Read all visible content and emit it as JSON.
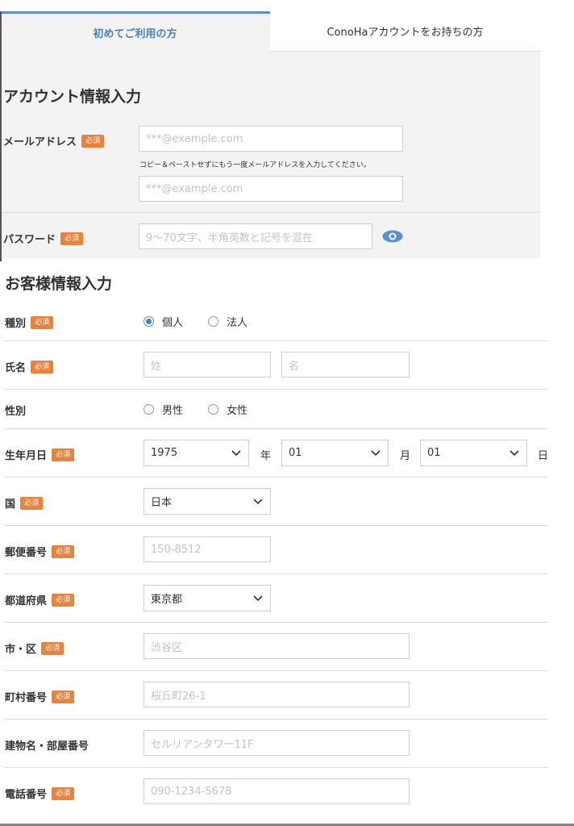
{
  "tabs": {
    "first_time": "初めてご利用の方",
    "existing": "ConoHaアカウントをお持ちの方"
  },
  "account": {
    "title": "アカウント情報入力",
    "email_label": "メールアドレス",
    "email_placeholder": "***@example.com",
    "email_hint": "コピー＆ペーストせずにもう一度メールアドレスを入力してください。",
    "email_confirm_placeholder": "***@example.com",
    "password_label": "パスワード",
    "password_placeholder": "9〜70文字、半角英数と記号を混在"
  },
  "required_badge": "必須",
  "customer": {
    "title": "お客様情報入力",
    "type_label": "種別",
    "type_options": [
      "個人",
      "法人"
    ],
    "type_selected": "個人",
    "name_label": "氏名",
    "last_name_placeholder": "姓",
    "first_name_placeholder": "名",
    "gender_label": "性別",
    "gender_options": [
      "男性",
      "女性"
    ],
    "birth_label": "生年月日",
    "birth_year": "1975",
    "birth_month": "01",
    "birth_day": "01",
    "unit_year": "年",
    "unit_month": "月",
    "unit_day": "日",
    "country_label": "国",
    "country_value": "日本",
    "postal_label": "郵便番号",
    "postal_placeholder": "150-8512",
    "prefecture_label": "都道府県",
    "prefecture_value": "東京都",
    "city_label": "市・区",
    "city_placeholder": "渋谷区",
    "town_label": "町村番号",
    "town_placeholder": "桜丘町26-1",
    "building_label": "建物名・部屋番号",
    "building_placeholder": "セルリアンタワー11F",
    "phone_label": "電話番号",
    "phone_placeholder": "090-1234-5678"
  },
  "colors": {
    "accent": "#4a7fc1",
    "badge": "#e8823c",
    "section_bg": "#f3f3f3"
  }
}
